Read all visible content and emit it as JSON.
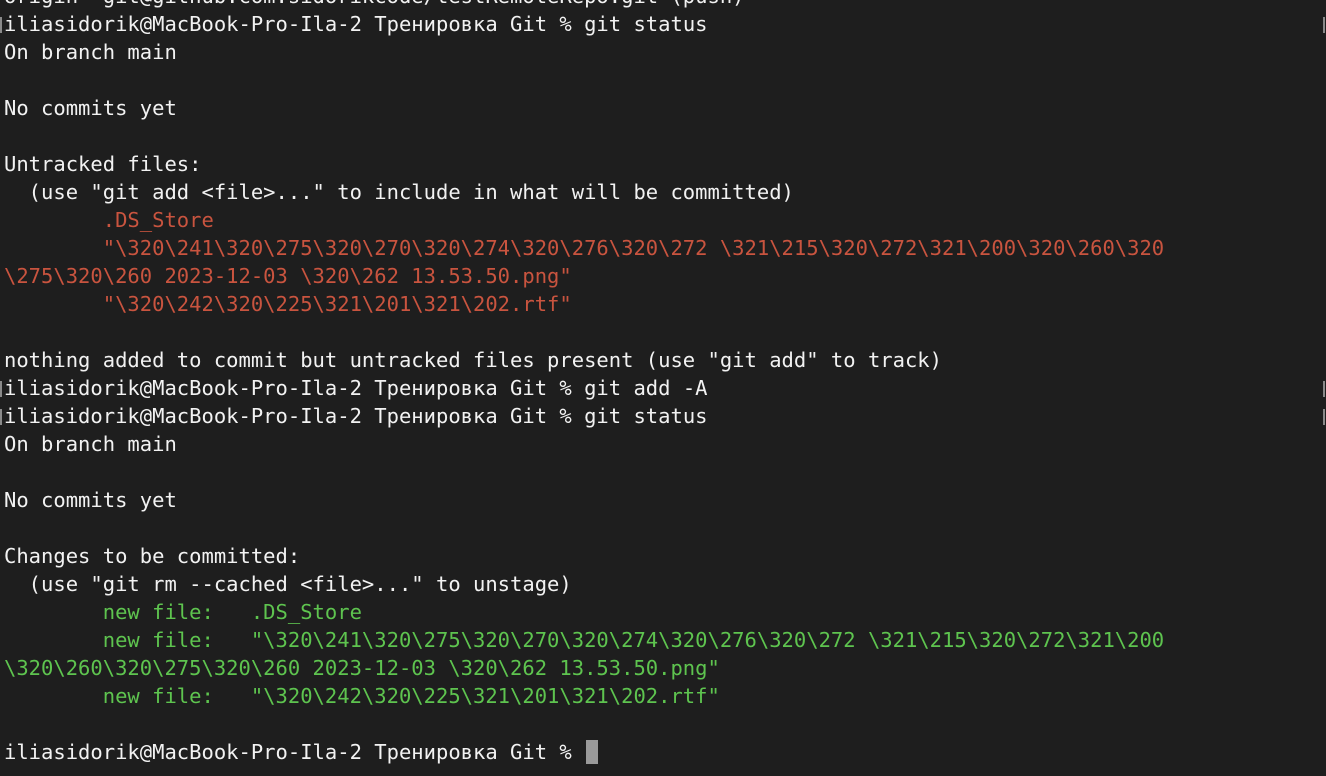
{
  "terminal": {
    "colors": {
      "background": "#1e1e1e",
      "text": "#f2f2f2",
      "untracked": "#c9543f",
      "staged": "#5ec44f",
      "cursor": "#9a9a9a"
    },
    "lines": [
      {
        "kind": "output",
        "text": "origin  git@github.com:sidorikcode/testRemoteRepo.git (push)"
      },
      {
        "kind": "prompt",
        "prompt": "iliasidorik@MacBook-Pro-Ila-2 Тренировка Git % ",
        "command": "git status"
      },
      {
        "kind": "output",
        "text": "On branch main"
      },
      {
        "kind": "blank",
        "text": ""
      },
      {
        "kind": "output",
        "text": "No commits yet"
      },
      {
        "kind": "blank",
        "text": ""
      },
      {
        "kind": "output",
        "text": "Untracked files:"
      },
      {
        "kind": "output",
        "text": "  (use \"git add <file>...\" to include in what will be committed)"
      },
      {
        "kind": "untracked",
        "text": "        .DS_Store"
      },
      {
        "kind": "untracked",
        "text": "        \"\\320\\241\\320\\275\\320\\270\\320\\274\\320\\276\\320\\272 \\321\\215\\320\\272\\321\\200\\320\\260\\320"
      },
      {
        "kind": "untracked",
        "text": "\\275\\320\\260 2023-12-03 \\320\\262 13.53.50.png\""
      },
      {
        "kind": "untracked",
        "text": "        \"\\320\\242\\320\\225\\321\\201\\321\\202.rtf\""
      },
      {
        "kind": "blank",
        "text": ""
      },
      {
        "kind": "output",
        "text": "nothing added to commit but untracked files present (use \"git add\" to track)"
      },
      {
        "kind": "prompt",
        "prompt": "iliasidorik@MacBook-Pro-Ila-2 Тренировка Git % ",
        "command": "git add -A"
      },
      {
        "kind": "prompt",
        "prompt": "iliasidorik@MacBook-Pro-Ila-2 Тренировка Git % ",
        "command": "git status"
      },
      {
        "kind": "output",
        "text": "On branch main"
      },
      {
        "kind": "blank",
        "text": ""
      },
      {
        "kind": "output",
        "text": "No commits yet"
      },
      {
        "kind": "blank",
        "text": ""
      },
      {
        "kind": "output",
        "text": "Changes to be committed:"
      },
      {
        "kind": "output",
        "text": "  (use \"git rm --cached <file>...\" to unstage)"
      },
      {
        "kind": "staged",
        "text": "        new file:   .DS_Store"
      },
      {
        "kind": "staged",
        "text": "        new file:   \"\\320\\241\\320\\275\\320\\270\\320\\274\\320\\276\\320\\272 \\321\\215\\320\\272\\321\\200"
      },
      {
        "kind": "staged",
        "text": "\\320\\260\\320\\275\\320\\260 2023-12-03 \\320\\262 13.53.50.png\""
      },
      {
        "kind": "staged",
        "text": "        new file:   \"\\320\\242\\320\\225\\321\\201\\321\\202.rtf\""
      },
      {
        "kind": "blank",
        "text": ""
      },
      {
        "kind": "active-prompt",
        "prompt": "iliasidorik@MacBook-Pro-Ila-2 Тренировка Git % ",
        "command": ""
      }
    ]
  }
}
